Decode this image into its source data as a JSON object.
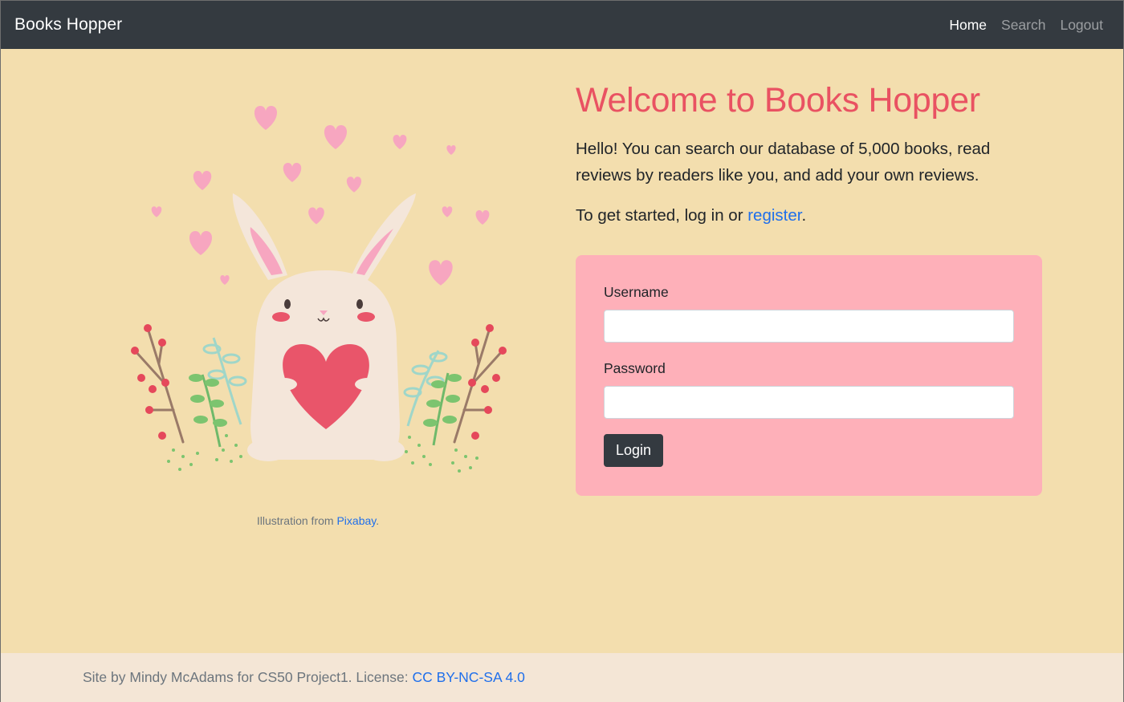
{
  "navbar": {
    "brand": "Books Hopper",
    "links": [
      {
        "label": "Home",
        "active": true
      },
      {
        "label": "Search",
        "active": false
      },
      {
        "label": "Logout",
        "active": false
      }
    ]
  },
  "illustration": {
    "icon": "bunny-with-heart-illustration",
    "caption_prefix": "Illustration from ",
    "caption_link": "Pixabay",
    "caption_suffix": "."
  },
  "main": {
    "title": "Welcome to Books Hopper",
    "intro": "Hello! You can search our database of 5,000 books, read reviews by readers like you, and add your own reviews.",
    "started_prefix": "To get started, log in or ",
    "started_link": "register",
    "started_suffix": "."
  },
  "login_form": {
    "username_label": "Username",
    "username_value": "",
    "password_label": "Password",
    "password_value": "",
    "button_label": "Login"
  },
  "footer": {
    "text": "Site by Mindy McAdams for CS50 Project1. License: ",
    "license_link": "CC BY-NC-SA 4.0"
  },
  "colors": {
    "page_bg": "#f3deae",
    "navbar_bg": "#343a40",
    "title": "#e95262",
    "form_bg": "#feb0b9",
    "footer_bg": "#f4e6d6",
    "link": "#1f6feb"
  }
}
